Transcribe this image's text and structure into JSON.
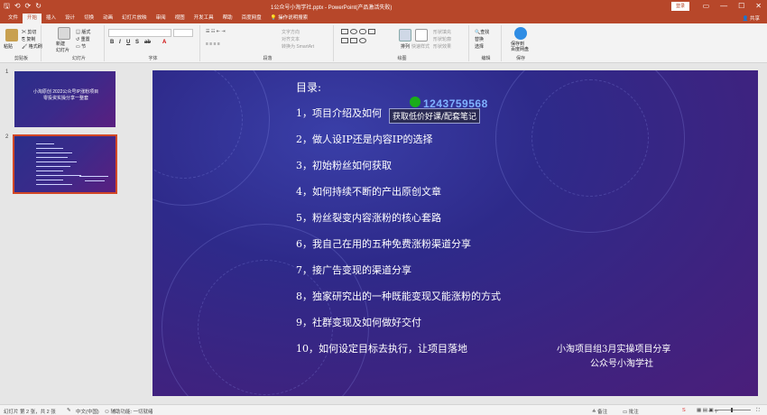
{
  "titlebar": {
    "qat": [
      "⟲",
      "⟳",
      "↻"
    ],
    "doc_title": "1公众号小淘学社.pptx  -  PowerPoint(产品激活失败)",
    "login": "登录",
    "ribbon_display": "▭",
    "minimize": "—",
    "maximize": "☐",
    "close": "✕"
  },
  "tabs": [
    "文件",
    "开始",
    "插入",
    "设计",
    "切换",
    "动画",
    "幻灯片放映",
    "审阅",
    "视图",
    "开发工具",
    "帮助",
    "百度网盘"
  ],
  "tell_me": "操作说明搜索",
  "share": "共享",
  "ribbon": {
    "clipboard": {
      "paste": "粘贴",
      "cut": "剪切",
      "copy": "复制",
      "format_painter": "格式刷",
      "label": "剪贴板"
    },
    "slides": {
      "new_slide": "新建\n幻灯片",
      "layout": "版式",
      "reset": "重置",
      "section": "节",
      "label": "幻灯片"
    },
    "font": {
      "font_name": "",
      "font_size": "",
      "label": "字体"
    },
    "paragraph": {
      "text_direction": "文字方向",
      "align_text": "对齐文本",
      "smartart": "转换为 SmartArt",
      "label": "段落"
    },
    "drawing": {
      "arrange": "排列",
      "quick_styles": "快速样式",
      "shape_fill": "形状填充",
      "shape_outline": "形状轮廓",
      "shape_effects": "形状效果",
      "label": "绘图"
    },
    "editing": {
      "find": "查找",
      "replace": "替换",
      "select": "选择",
      "label": "编辑"
    },
    "save": {
      "button": "保存到\n百度网盘",
      "label": "保存"
    }
  },
  "slides_pane": {
    "items": [
      {
        "num": "1",
        "title": "小淘原创 2022公众号IP涨粉项目\n零投资实操分享一整套"
      },
      {
        "num": "2",
        "title": ""
      }
    ]
  },
  "slide": {
    "title": "目录:",
    "items": [
      "1，项目介绍及如何",
      "2，做人设IP还是内容IP的选择",
      "3，初始粉丝如何获取",
      "4，如何持续不断的产出原创文章",
      "5，粉丝裂变内容涨粉的核心套路",
      "6，我自己在用的五种免费涨粉渠道分享",
      "7，接广告变现的渠道分享",
      "8，独家研究出的一种既能变现又能涨粉的方式",
      "9，社群变现及如何做好交付",
      "10，如何设定目标去执行，让项目落地"
    ],
    "watermark_qq": "1243759568",
    "watermark_tag": "获取低价好课/配套笔记",
    "footer_line1": "小淘项目组3月实操项目分享",
    "footer_line2": "公众号小淘学社"
  },
  "statusbar": {
    "slide_info": "幻灯片 第 2 张，共 2 张",
    "language": "中文(中国)",
    "accessibility": "辅助功能: 一切就绪",
    "notes": "备注",
    "comments": "批注",
    "zoom": "－ ＋"
  },
  "colors": {
    "accent": "#b7472a",
    "slide_bg": "#35288a"
  }
}
